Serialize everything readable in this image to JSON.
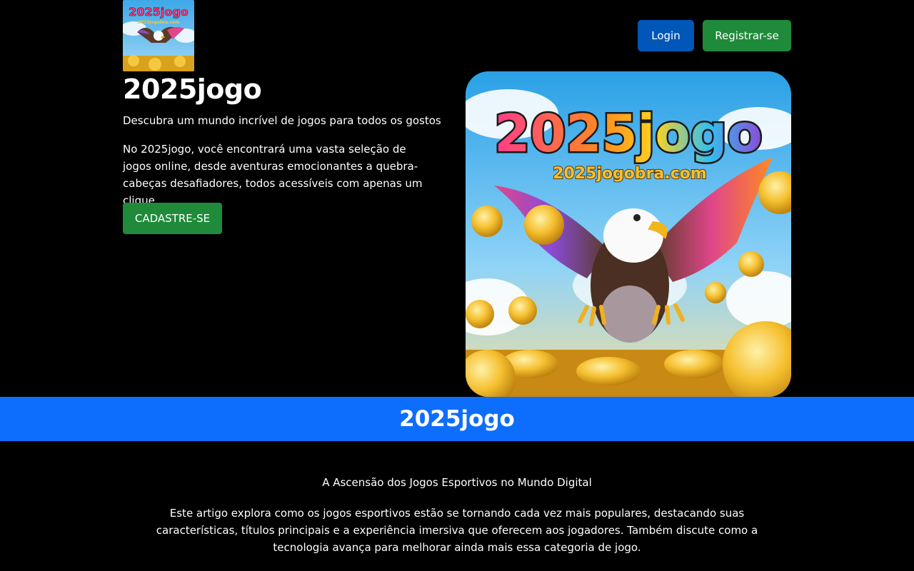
{
  "header": {
    "logo_alt": "2025jogo logo",
    "login_label": "Login",
    "register_label": "Registrar-se"
  },
  "hero": {
    "title": "2025jogo",
    "subtitle": "Descubra um mundo incrível de jogos para todos os gostos",
    "body": "No 2025jogo, você encontrará uma vasta seleção de jogos online, desde aventuras emocionantes a quebra-cabeças desafiadores, todos acessíveis com apenas um clique.",
    "cta_label": "CADASTRE-SE",
    "image": {
      "brand_text": "2025jogo",
      "domain_text": "2025jogobra.com"
    }
  },
  "band": {
    "title": "2025jogo",
    "color": "#0d6efd"
  },
  "article": {
    "title": "A Ascensão dos Jogos Esportivos no Mundo Digital",
    "body": "Este artigo explora como os jogos esportivos estão se tornando cada vez mais populares, destacando suas características, títulos principais e a experiência imersiva que oferecem aos jogadores. Também discute como a tecnologia avança para melhorar ainda mais essa categoria de jogo."
  },
  "colors": {
    "login_button": "#0057b7",
    "register_button": "#1f8a3a",
    "background": "#000000"
  }
}
